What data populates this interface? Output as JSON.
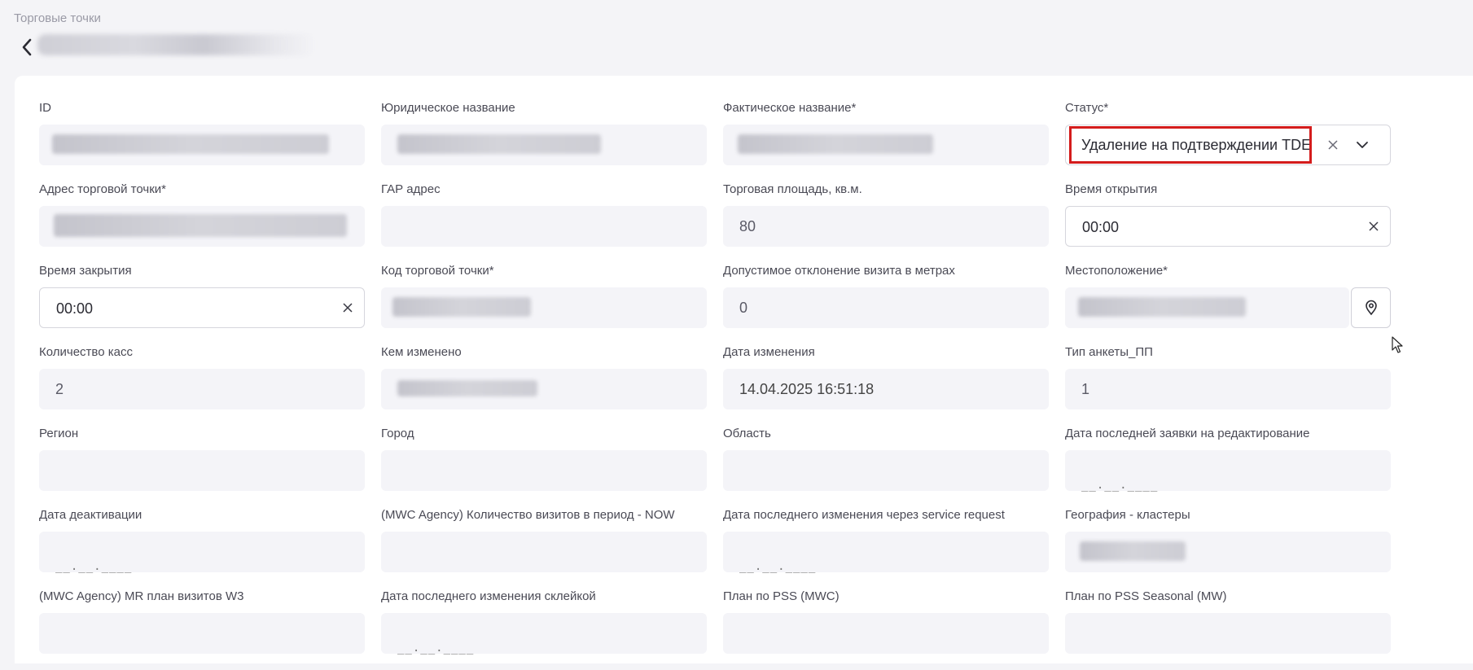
{
  "breadcrumb": "Торговые точки",
  "fields": {
    "id": {
      "label": "ID"
    },
    "legal_name": {
      "label": "Юридическое название"
    },
    "actual_name": {
      "label": "Фактическое название*"
    },
    "status": {
      "label": "Статус*",
      "value": "Удаление на подтверждении TDE"
    },
    "address": {
      "label": "Адрес торговой точки*"
    },
    "gar_address": {
      "label": "ГАР адрес",
      "value": ""
    },
    "trade_area": {
      "label": "Торговая площадь, кв.м.",
      "value": "80"
    },
    "open_time": {
      "label": "Время открытия",
      "value": "00:00"
    },
    "close_time": {
      "label": "Время закрытия",
      "value": "00:00"
    },
    "outlet_code": {
      "label": "Код торговой точки*"
    },
    "visit_deviation": {
      "label": "Допустимое отклонение визита в метрах",
      "value": "0"
    },
    "location": {
      "label": "Местоположение*"
    },
    "cash_registers": {
      "label": "Количество касс",
      "value": "2"
    },
    "changed_by": {
      "label": "Кем изменено"
    },
    "changed_date": {
      "label": "Дата изменения",
      "value": "14.04.2025 16:51:18"
    },
    "survey_type": {
      "label": "Тип анкеты_ПП",
      "value": "1"
    },
    "region": {
      "label": "Регион",
      "value": ""
    },
    "city": {
      "label": "Город",
      "value": ""
    },
    "oblast": {
      "label": "Область",
      "value": ""
    },
    "last_edit_request_date": {
      "label": "Дата последней заявки на редактирование",
      "value": "__.__.____"
    },
    "deactivation_date": {
      "label": "Дата деактивации",
      "value": "__.__.____"
    },
    "mwc_visits_now": {
      "label": "(MWC Agency) Количество визитов в период - NOW",
      "value": ""
    },
    "last_change_service_request": {
      "label": "Дата последнего изменения через service request",
      "value": "__.__.____"
    },
    "geo_clusters": {
      "label": "География - кластеры"
    },
    "mwc_mr_plan_w3": {
      "label": "(MWC Agency) MR план визитов W3",
      "value": ""
    },
    "last_change_merge": {
      "label": "Дата последнего изменения склейкой",
      "value": "__.__.____"
    },
    "pss_plan_mwc": {
      "label": "План по PSS (MWC)",
      "value": ""
    },
    "pss_plan_seasonal": {
      "label": "План по PSS Seasonal (MW)",
      "value": ""
    }
  },
  "icons": {
    "back": "chevron-left-icon",
    "clear": "close-icon",
    "dropdown": "chevron-down-icon",
    "collapse": "double-chevron-up-icon",
    "location": "map-pin-icon"
  },
  "colors": {
    "highlight": "#d41c1c"
  }
}
